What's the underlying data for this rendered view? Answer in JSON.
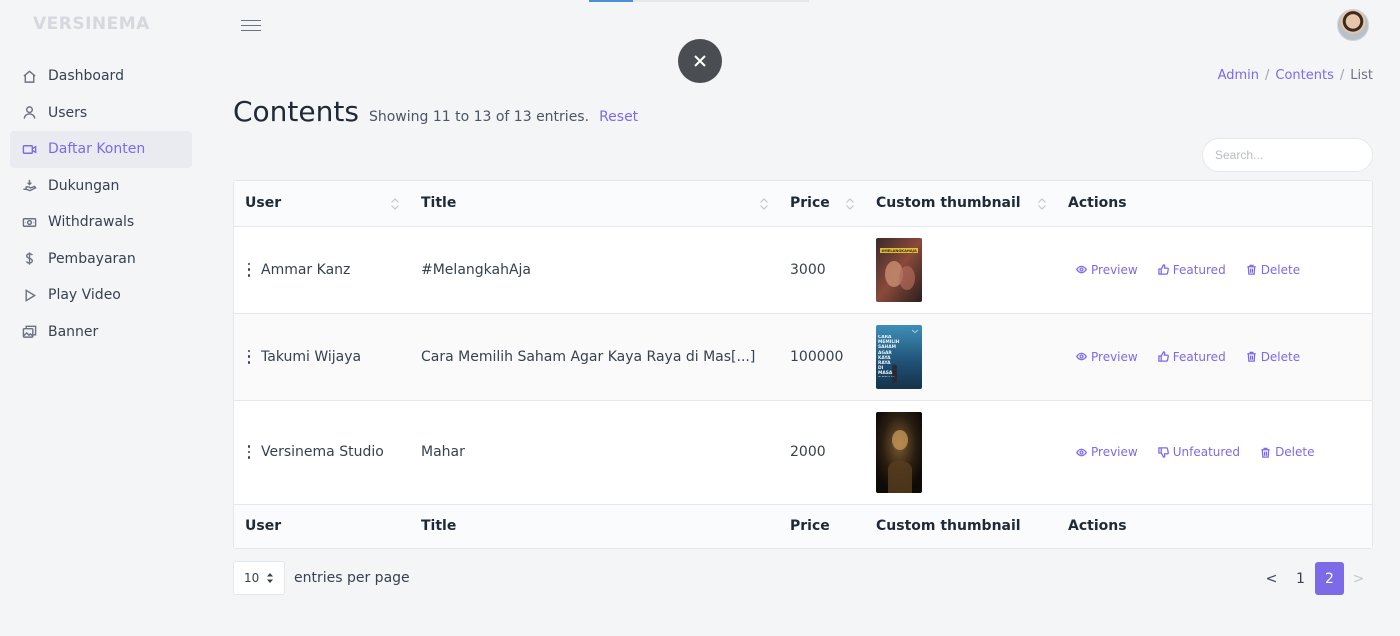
{
  "brand": "VERSINEMA",
  "sidebar": {
    "items": [
      {
        "label": "Dashboard",
        "icon": "home-icon"
      },
      {
        "label": "Users",
        "icon": "user-icon"
      },
      {
        "label": "Daftar Konten",
        "icon": "video-camera-icon",
        "active": true
      },
      {
        "label": "Dukungan",
        "icon": "hand-coin-icon"
      },
      {
        "label": "Withdrawals",
        "icon": "money-bill-icon"
      },
      {
        "label": "Pembayaran",
        "icon": "dollar-icon"
      },
      {
        "label": "Play Video",
        "icon": "play-icon"
      },
      {
        "label": "Banner",
        "icon": "image-gallery-icon"
      }
    ]
  },
  "top_progress": 0.2,
  "breadcrumb": {
    "admin": "Admin",
    "contents": "Contents",
    "current": "List",
    "separator": "/"
  },
  "page": {
    "title": "Contents",
    "entries_info": "Showing 11 to 13 of 13 entries.",
    "reset": "Reset"
  },
  "search": {
    "placeholder": "Search...",
    "value": ""
  },
  "table": {
    "headers": {
      "user": "User",
      "title": "Title",
      "price": "Price",
      "thumb": "Custom thumbnail",
      "actions": "Actions"
    },
    "rows": [
      {
        "user": "Ammar Kanz",
        "title": "#MelangkahAja",
        "price": "3000",
        "thumb_label": "#MELANGKAHAJA",
        "preview": "Preview",
        "feature": "Featured",
        "delete": "Delete"
      },
      {
        "user": "Takumi Wijaya",
        "title": "Cara Memilih Saham Agar Kaya Raya di Mas[...]",
        "price": "100000",
        "thumb_label": "CARA MEMILIH SAHAM AGAR KAYA RAYA DI MASA DEPAN",
        "preview": "Preview",
        "feature": "Featured",
        "delete": "Delete"
      },
      {
        "user": "Versinema Studio",
        "title": "Mahar",
        "price": "2000",
        "thumb_label": "",
        "preview": "Preview",
        "feature": "Unfeatured",
        "delete": "Delete"
      }
    ]
  },
  "footer": {
    "per_page_value": "10",
    "per_page_label": "entries per page",
    "pagination": {
      "prev": "<",
      "pages": [
        "1",
        "2"
      ],
      "active": "2",
      "next": ">"
    }
  },
  "colors": {
    "accent": "#7c6ae6",
    "text": "#374151"
  }
}
